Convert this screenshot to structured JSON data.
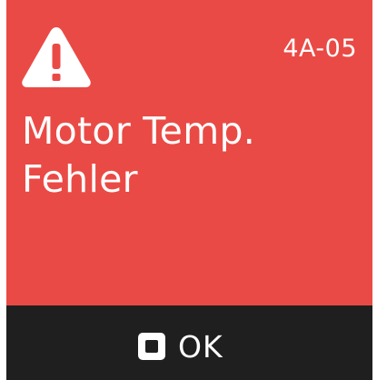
{
  "alert": {
    "code": "4A-05",
    "message_line1": "Motor Temp.",
    "message_line2": "Fehler",
    "icon": "warning-triangle-icon",
    "background_color": "#ea4a45"
  },
  "footer": {
    "ok_label": "OK",
    "ok_icon": "square-button-icon",
    "background_color": "#1f1f1f"
  }
}
